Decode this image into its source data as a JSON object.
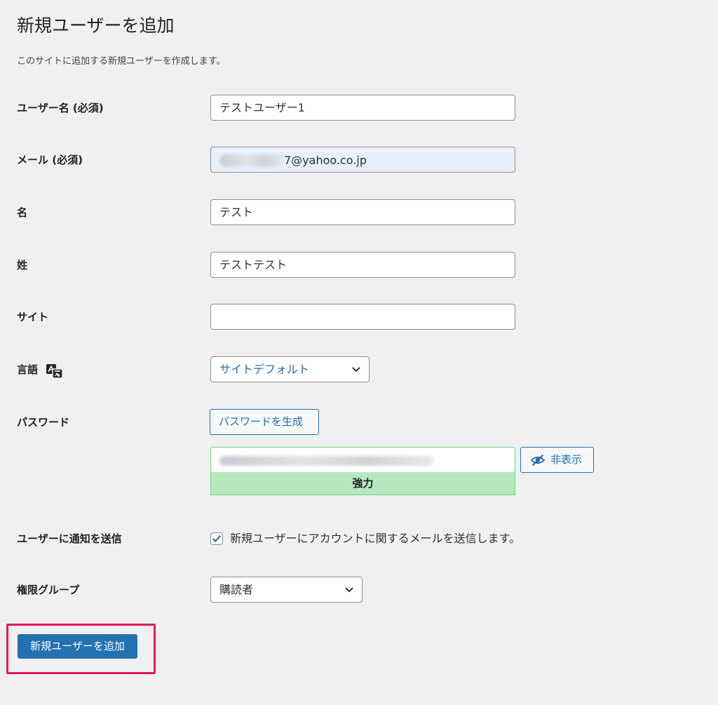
{
  "page": {
    "title": "新規ユーザーを追加",
    "intro": "このサイトに追加する新規ユーザーを作成します。"
  },
  "fields": {
    "username": {
      "label": "ユーザー名 (必須)",
      "value": "テストユーザー1"
    },
    "email": {
      "label": "メール (必須)",
      "value_visible": "7@yahoo.co.jp"
    },
    "first_name": {
      "label": "名",
      "value": "テスト"
    },
    "last_name": {
      "label": "姓",
      "value": "テストテスト"
    },
    "website": {
      "label": "サイト",
      "value": ""
    },
    "language": {
      "label": "言語",
      "icon": "translation-icon",
      "selected": "サイトデフォルト"
    },
    "password": {
      "label": "パスワード",
      "generate_button": "パスワードを生成",
      "hide_button": "非表示",
      "hide_icon": "eye-slash-icon",
      "strength": "強力"
    },
    "notify": {
      "label": "ユーザーに通知を送信",
      "checked": true,
      "checkbox_text": "新規ユーザーにアカウントに関するメールを送信します。"
    },
    "role": {
      "label": "権限グループ",
      "selected": "購読者"
    }
  },
  "submit": {
    "label": "新規ユーザーを追加"
  },
  "colors": {
    "primary": "#2271b1",
    "strength_bg": "#b8e6bf",
    "strength_border": "#68de7c",
    "highlight": "#e8175d",
    "background": "#f0f0f1"
  }
}
